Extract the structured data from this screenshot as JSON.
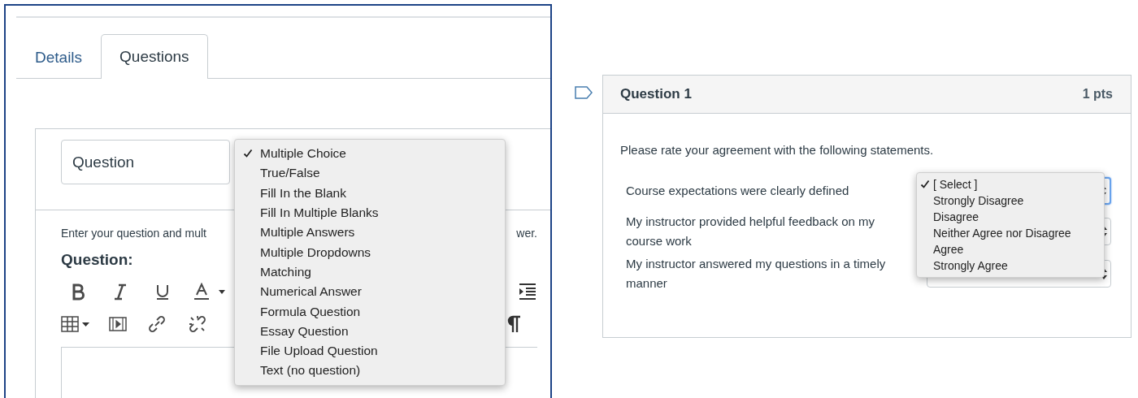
{
  "editor": {
    "tabs": [
      {
        "label": "Details",
        "selected": false
      },
      {
        "label": "Questions",
        "selected": true
      }
    ],
    "title_field": {
      "value": "Question"
    },
    "instruction": {
      "start": "Enter your question and mult",
      "end": "wer."
    },
    "question_label": "Question:",
    "type_menu": [
      {
        "label": "Multiple Choice",
        "selected": true
      },
      {
        "label": "True/False",
        "selected": false
      },
      {
        "label": "Fill In the Blank",
        "selected": false
      },
      {
        "label": "Fill In Multiple Blanks",
        "selected": false
      },
      {
        "label": "Multiple Answers",
        "selected": false
      },
      {
        "label": "Multiple Dropdowns",
        "selected": false
      },
      {
        "label": "Matching",
        "selected": false
      },
      {
        "label": "Numerical Answer",
        "selected": false
      },
      {
        "label": "Formula Question",
        "selected": false
      },
      {
        "label": "Essay Question",
        "selected": false
      },
      {
        "label": "File Upload Question",
        "selected": false
      },
      {
        "label": "Text (no question)",
        "selected": false
      }
    ]
  },
  "preview": {
    "title": "Question 1",
    "points": "1 pts",
    "prompt": "Please rate your agreement with the following statements.",
    "statements": [
      {
        "text": "Course expectations were clearly defined",
        "focused": true
      },
      {
        "text": "My instructor provided helpful feedback on my course work",
        "focused": false
      },
      {
        "text": "My instructor answered my questions in a timely manner",
        "focused": false
      }
    ],
    "answer_menu": [
      {
        "label": "[ Select ]",
        "selected": true
      },
      {
        "label": "Strongly Disagree",
        "selected": false
      },
      {
        "label": "Disagree",
        "selected": false
      },
      {
        "label": "Neither Agree nor Disagree",
        "selected": false
      },
      {
        "label": "Agree",
        "selected": false
      },
      {
        "label": "Strongly Agree",
        "selected": false
      }
    ]
  }
}
